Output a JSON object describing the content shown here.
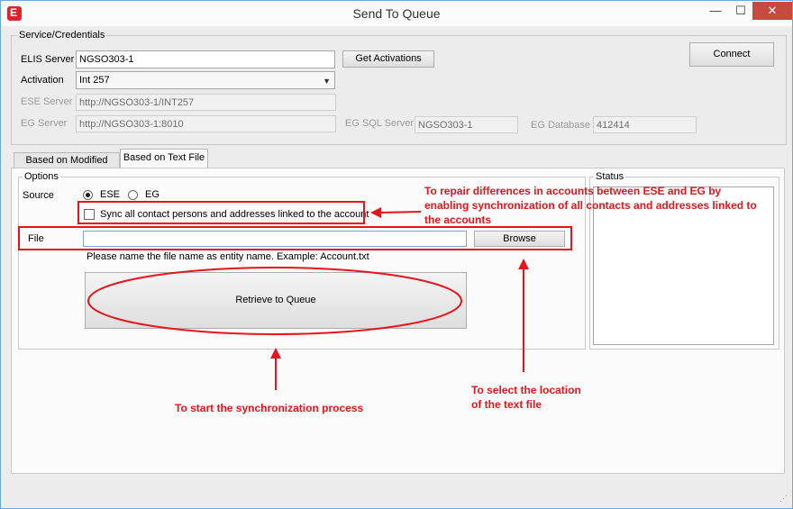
{
  "window": {
    "title": "Send To Queue",
    "app_icon_letter": "E",
    "minimize_glyph": "—",
    "maximize_glyph": "☐",
    "close_glyph": "✕"
  },
  "credentials": {
    "group_label": "Service/Credentials",
    "elis_label": "ELIS Server",
    "elis_value": "NGSO303-1",
    "get_activations_label": "Get Activations",
    "activation_label": "Activation",
    "activation_value": "Int 257",
    "ese_label": "ESE Server",
    "ese_value": "http://NGSO303-1/INT257",
    "eg_label": "EG Server",
    "eg_value": "http://NGSO303-1:8010",
    "eg_sql_label": "EG SQL Server",
    "eg_sql_value": "NGSO303-1",
    "eg_db_label": "EG Database",
    "eg_db_value": "412414",
    "connect_label": "Connect"
  },
  "tabs": [
    {
      "label": "Based on Modified Date",
      "active": false
    },
    {
      "label": "Based on Text File",
      "active": true
    }
  ],
  "options": {
    "group_label": "Options",
    "source_label": "Source",
    "radio_ese": "ESE",
    "radio_eg": "EG",
    "selected_source": "ESE",
    "sync_label": "Sync all contact persons and addresses linked to the account",
    "sync_checked": false,
    "file_label": "File",
    "file_value": "",
    "browse_label": "Browse",
    "hint": "Please name the file name as entity name. Example: Account.txt",
    "retrieve_label": "Retrieve to Queue"
  },
  "status": {
    "group_label": "Status"
  },
  "annotations": {
    "sync_note_lines": [
      "To repair differences in accounts between ESE and EG by",
      "enabling synchronization of all contacts and addresses linked to",
      "the accounts"
    ],
    "start_note": "To start the synchronization process",
    "browse_note_lines": [
      "To select the location",
      "of the text file"
    ],
    "color": "#e8141b"
  },
  "resize_grip_glyph": "⋰"
}
